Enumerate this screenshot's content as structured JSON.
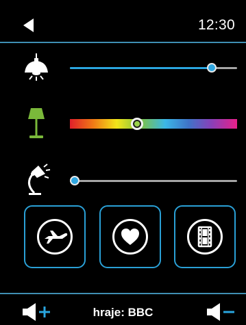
{
  "header": {
    "back_icon": "back-triangle-icon",
    "time": "12:30"
  },
  "lights": [
    {
      "icon": "pendant-lamp-icon",
      "slider_type": "level",
      "value_pct": 85
    },
    {
      "icon": "floor-lamp-icon",
      "slider_type": "color",
      "value_pct": 40,
      "thumb_color": "#9ad14a"
    },
    {
      "icon": "desk-lamp-icon",
      "slider_type": "level",
      "value_pct": 3
    }
  ],
  "scenes": [
    {
      "icon": "airplane-icon"
    },
    {
      "icon": "heart-icon"
    },
    {
      "icon": "film-icon"
    }
  ],
  "footer": {
    "volume_up_icon": "volume-up-icon",
    "now_playing_label": "hraje:",
    "now_playing_value": "BBC",
    "volume_down_icon": "volume-down-icon"
  },
  "colors": {
    "accent": "#2aa6e0",
    "line": "#3f8fb3",
    "lamp_white": "#ffffff",
    "lamp_green": "#7ab83a",
    "background": "#000000"
  }
}
